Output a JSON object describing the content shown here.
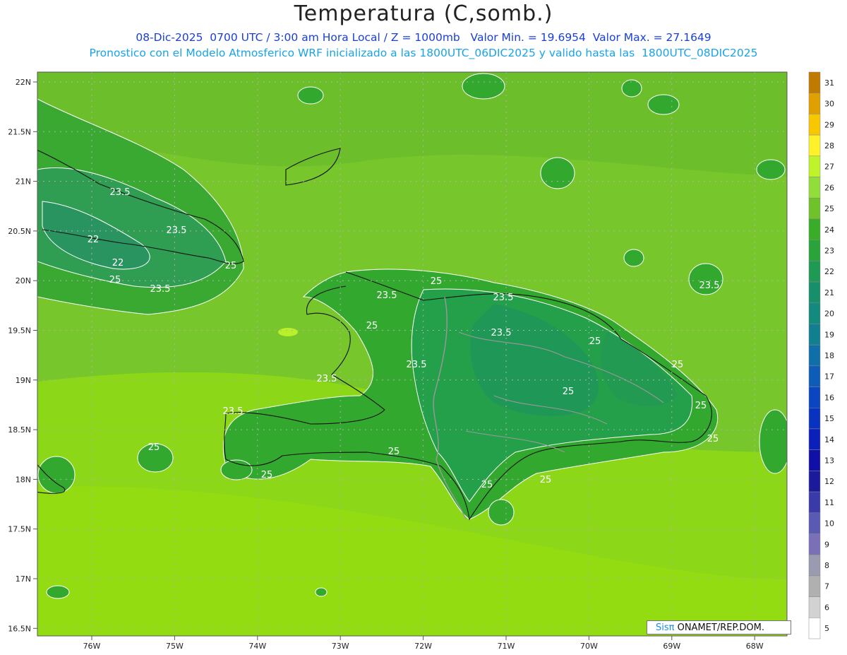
{
  "header": {
    "title": "Temperatura (C,somb.)",
    "line1": "08-Dic-2025  0700 UTC / 3:00 am Hora Local / Z = 1000mb   Valor Min. = 19.6954  Valor Max. = 27.1649",
    "line2": "Pronostico con el Modelo Atmosferico WRF inicializado a las 1800UTC_06DIC2025 y valido hasta las  1800UTC_08DIC2025"
  },
  "axes": {
    "lat_ticks": [
      "22N",
      "21.5N",
      "21N",
      "20.5N",
      "20N",
      "19.5N",
      "19N",
      "18.5N",
      "18N",
      "17.5N",
      "17N",
      "16.5N"
    ],
    "lon_ticks": [
      "76W",
      "75W",
      "74W",
      "73W",
      "72W",
      "71W",
      "70W",
      "69W",
      "68W"
    ]
  },
  "colorbar": {
    "labels": [
      "31",
      "30",
      "29",
      "28",
      "27",
      "26",
      "25",
      "24",
      "23",
      "22",
      "21",
      "20",
      "19",
      "18",
      "17",
      "16",
      "15",
      "14",
      "13",
      "12",
      "11",
      "10",
      "9",
      "8",
      "7",
      "6",
      "5"
    ],
    "colors": [
      "#c07a00",
      "#e0a000",
      "#f7c800",
      "#fff22a",
      "#bff32a",
      "#92dd3a",
      "#6fc22a",
      "#3aad28",
      "#28a43a",
      "#1f9a55",
      "#178f6b",
      "#138a7e",
      "#108090",
      "#0f6fa8",
      "#0c5cb8",
      "#0a46c0",
      "#0833c0",
      "#0a20b8",
      "#1010a8",
      "#1a1a9a",
      "#3a3aa8",
      "#5a5ab5",
      "#7a70b8",
      "#9a9ab0",
      "#b0b0b0",
      "#d2d2d2",
      "#ffffff"
    ]
  },
  "contour_labels": [
    "23.5",
    "23.5",
    "22",
    "22",
    "25",
    "25",
    "23.5",
    "23.5",
    "25",
    "25",
    "23.5",
    "23.5",
    "25",
    "23.5",
    "23.5",
    "25",
    "25",
    "23.5",
    "25",
    "25",
    "25",
    "23.5",
    "25",
    "25",
    "25",
    "25"
  ],
  "credit": {
    "brand": "Sisπ",
    "text": " ONAMET/REP.DOM."
  }
}
